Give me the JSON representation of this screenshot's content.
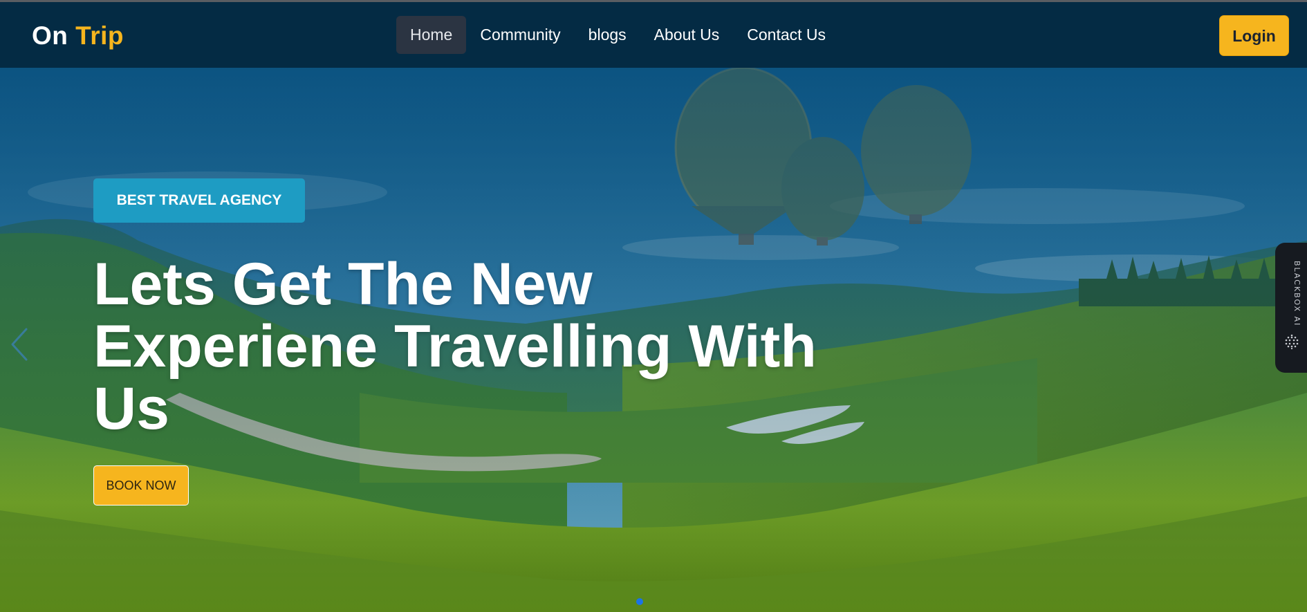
{
  "brand": {
    "first": "On",
    "second": "Trip",
    "accent_color": "#f6b51e"
  },
  "nav": {
    "items": [
      {
        "label": "Home",
        "active": true
      },
      {
        "label": "Community",
        "active": false
      },
      {
        "label": "blogs",
        "active": false
      },
      {
        "label": "About Us",
        "active": false
      },
      {
        "label": "Contact Us",
        "active": false
      }
    ],
    "login_label": "Login"
  },
  "hero": {
    "badge": "BEST TRAVEL AGENCY",
    "headline_line1": "Lets Get The New",
    "headline_line2": "Experiene Travelling With",
    "headline_line3": "Us",
    "cta_label": "BOOK NOW",
    "prev_icon": "chevron-left-icon",
    "slide_count": 1,
    "active_slide": 1
  },
  "side_widget": {
    "label": "BLACKBOX AI",
    "icon": "blackbox-logo-icon"
  },
  "colors": {
    "navbar_bg": "#042b44",
    "badge_bg": "#1e9cc3",
    "button_yellow": "#f6b51e",
    "dot_active": "#1a73e8"
  }
}
